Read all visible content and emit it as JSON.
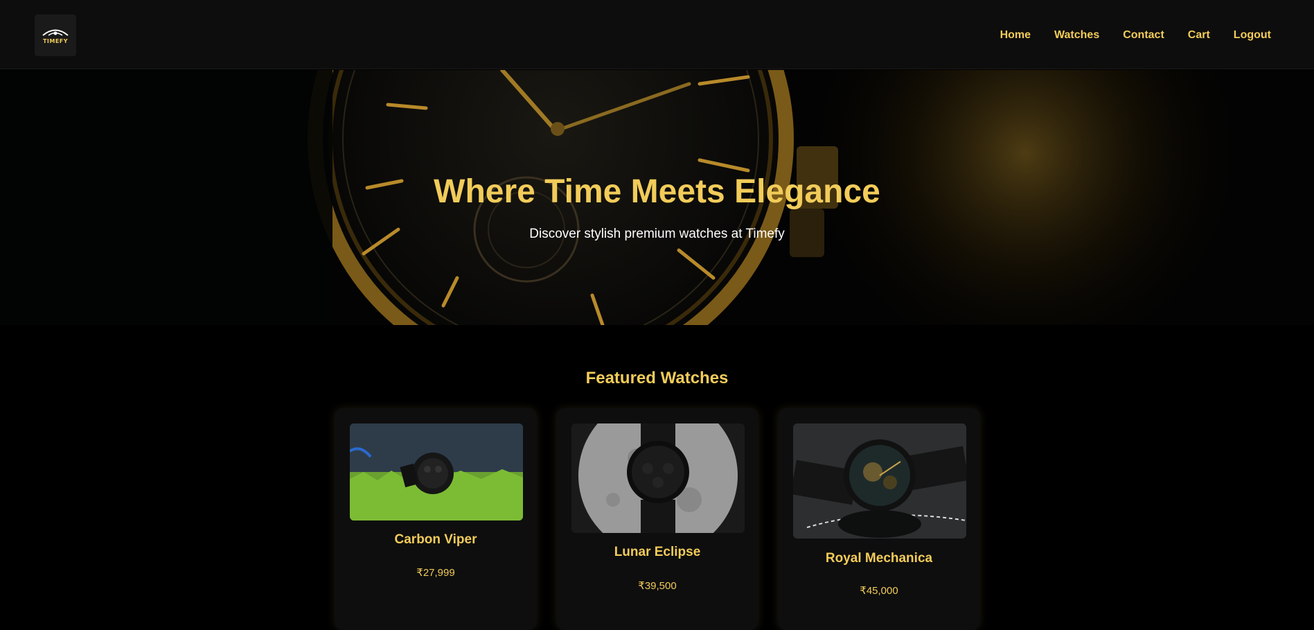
{
  "brand": {
    "logo_text": "TIMEFY"
  },
  "nav": {
    "links": [
      {
        "label": "Home"
      },
      {
        "label": "Watches"
      },
      {
        "label": "Contact"
      },
      {
        "label": "Cart"
      },
      {
        "label": "Logout"
      }
    ]
  },
  "hero": {
    "title": "Where Time Meets Elegance",
    "subtitle": "Discover stylish premium watches at Timefy"
  },
  "featured": {
    "heading": "Featured Watches",
    "products": [
      {
        "name": "Carbon Viper",
        "price": "₹27,999"
      },
      {
        "name": "Lunar Eclipse",
        "price": "₹39,500"
      },
      {
        "name": "Royal Mechanica",
        "price": "₹45,000"
      }
    ]
  },
  "colors": {
    "accent": "#f2cc5a",
    "background": "#000000",
    "navbar": "#0d0d0d",
    "card": "#0e0e0e"
  }
}
